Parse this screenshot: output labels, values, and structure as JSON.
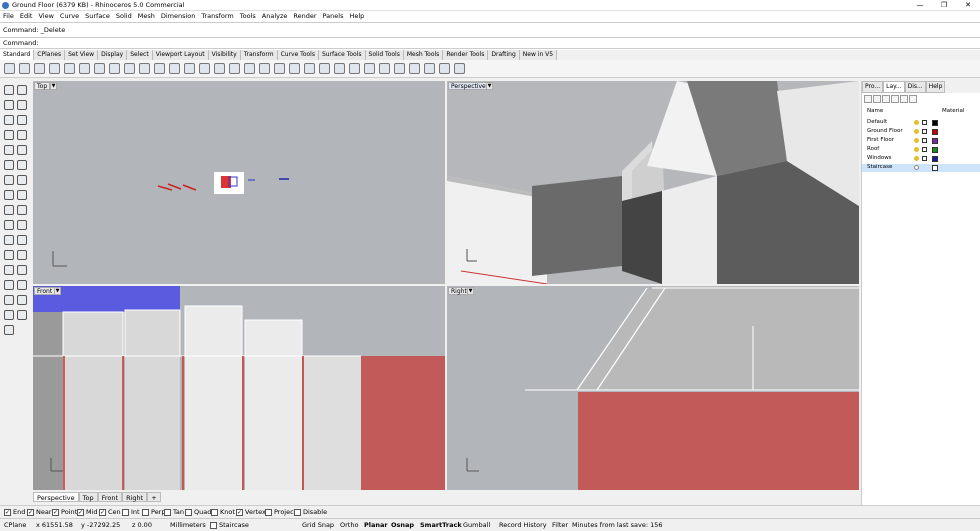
{
  "app": {
    "title": "Ground Floor (6379 KB) - Rhinoceros 5.0 Commercial",
    "min": "—",
    "max": "❐",
    "close": "✕"
  },
  "menu": [
    "File",
    "Edit",
    "View",
    "Curve",
    "Surface",
    "Solid",
    "Mesh",
    "Dimension",
    "Transform",
    "Tools",
    "Analyze",
    "Render",
    "Panels",
    "Help"
  ],
  "command": {
    "history": "Command: _Delete",
    "prompt": "Command:"
  },
  "toolbar_tabs": [
    "Standard",
    "CPlanes",
    "Set View",
    "Display",
    "Select",
    "Viewport Layout",
    "Visibility",
    "Transform",
    "Curve Tools",
    "Surface Tools",
    "Solid Tools",
    "Mesh Tools",
    "Render Tools",
    "Drafting",
    "New in V5"
  ],
  "viewports": {
    "top": "Top",
    "perspective": "Perspective",
    "front": "Front",
    "right": "Right"
  },
  "viewport_tabs": [
    "Perspective",
    "Top",
    "Front",
    "Right",
    "+"
  ],
  "panel": {
    "tabs": [
      "Pro...",
      "Lay...",
      "Dis...",
      "Help"
    ],
    "col_name": "Name",
    "col_material": "Material",
    "layers": [
      {
        "name": "Default",
        "color": "#000000"
      },
      {
        "name": "Ground Floor",
        "color": "#cc0000"
      },
      {
        "name": "First Floor",
        "color": "#7a2aa0"
      },
      {
        "name": "Roof",
        "color": "#1a8a1a"
      },
      {
        "name": "Windows",
        "color": "#1a1aa0"
      },
      {
        "name": "Staircase",
        "color": "#ffffff"
      }
    ]
  },
  "osnaps": [
    {
      "label": "End",
      "checked": true
    },
    {
      "label": "Near",
      "checked": true
    },
    {
      "label": "Point",
      "checked": true
    },
    {
      "label": "Mid",
      "checked": true
    },
    {
      "label": "Cen",
      "checked": true
    },
    {
      "label": "Int",
      "checked": false
    },
    {
      "label": "Perp",
      "checked": false
    },
    {
      "label": "Tan",
      "checked": false
    },
    {
      "label": "Quad",
      "checked": false
    },
    {
      "label": "Knot",
      "checked": false
    },
    {
      "label": "Vertex",
      "checked": true
    },
    {
      "label": "Project",
      "checked": false
    },
    {
      "label": "Disable",
      "checked": false
    }
  ],
  "status": {
    "cplane": "CPlane",
    "x": "x 61551.58",
    "y": "y -27292.25",
    "z": "z 0.00",
    "units": "Millimeters",
    "layer": "Staircase",
    "grid_snap": "Grid Snap",
    "ortho": "Ortho",
    "planar": "Planar",
    "osnap": "Osnap",
    "smarttrack": "SmartTrack",
    "gumball": "Gumball",
    "record_history": "Record History",
    "filter": "Filter",
    "save": "Minutes from last save: 156"
  }
}
